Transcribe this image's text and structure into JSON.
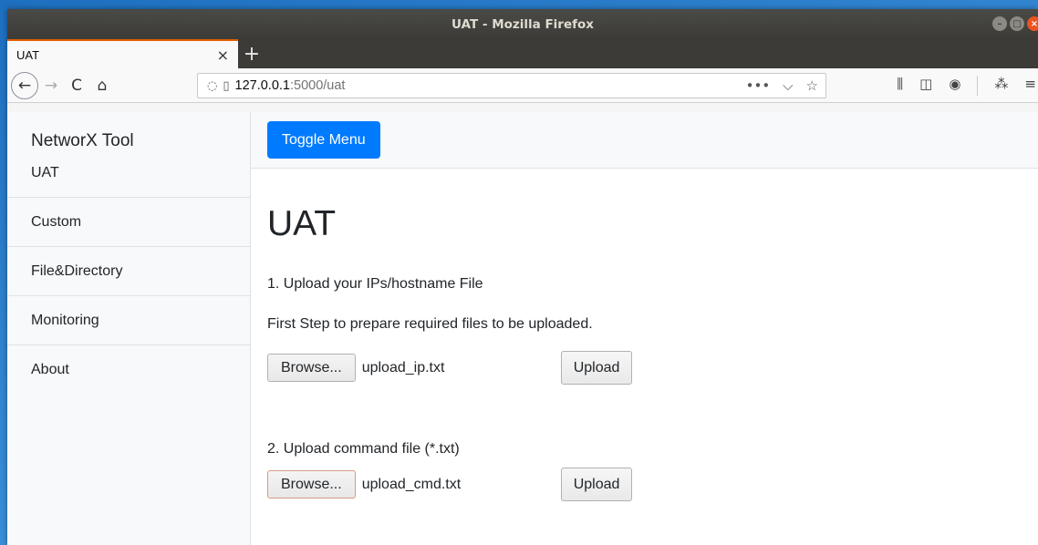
{
  "window": {
    "title": "UAT - Mozilla Firefox"
  },
  "tab": {
    "label": "UAT",
    "close": "×",
    "new": "+"
  },
  "nav": {
    "back": "←",
    "forward": "→",
    "reload": "C",
    "home": "⌂",
    "url_host": "127.0.0.1",
    "url_path": ":5000/uat",
    "url_actions": {
      "more": "•••",
      "pocket": "⌵",
      "bookmark": "☆"
    }
  },
  "sidebar": {
    "brand": "NetworX Tool",
    "items": [
      {
        "label": "UAT"
      },
      {
        "label": "Custom"
      },
      {
        "label": "File&Directory"
      },
      {
        "label": "Monitoring"
      },
      {
        "label": "About"
      }
    ]
  },
  "topbar": {
    "toggle_label": "Toggle Menu"
  },
  "main": {
    "title": "UAT",
    "step1": {
      "heading": "1. Upload your IPs/hostname File",
      "note": "First Step to prepare required files to be uploaded.",
      "browse_label": "Browse...",
      "filename": "upload_ip.txt",
      "upload_label": "Upload"
    },
    "step2": {
      "heading": "2. Upload command file (*.txt)",
      "browse_label": "Browse...",
      "filename": "upload_cmd.txt",
      "upload_label": "Upload"
    }
  },
  "colors": {
    "primary": "#007bff",
    "tab_accent": "#e66000",
    "titlebar": "#3c3b37"
  }
}
